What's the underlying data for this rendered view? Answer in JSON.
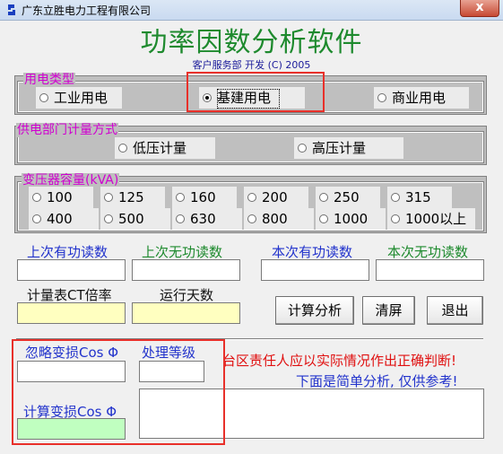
{
  "window": {
    "title": "广东立胜电力工程有限公司",
    "close_glyph": "x"
  },
  "header": {
    "title": "功率因数分析软件",
    "subtitle": "客户服务部 开发 (C) 2005"
  },
  "usage_type": {
    "label": "用电类型",
    "options": [
      {
        "label": "工业用电",
        "selected": false
      },
      {
        "label": "基建用电",
        "selected": true
      },
      {
        "label": "商业用电",
        "selected": false
      }
    ]
  },
  "metering": {
    "label": "供电部门计量方式",
    "options": [
      {
        "label": "低压计量",
        "selected": false
      },
      {
        "label": "高压计量",
        "selected": false
      }
    ]
  },
  "capacity": {
    "label": "变压器容量(kVA)",
    "options": [
      "100",
      "125",
      "160",
      "200",
      "250",
      "315",
      "400",
      "500",
      "630",
      "800",
      "1000",
      "1000以上"
    ]
  },
  "readings": {
    "last_active": "上次有功读数",
    "last_reactive": "上次无功读数",
    "this_active": "本次有功读数",
    "this_reactive": "本次无功读数",
    "ct_ratio": "计量表CT倍率",
    "run_days": "运行天数"
  },
  "buttons": {
    "calculate": "计算分析",
    "clear": "清屏",
    "exit": "退出"
  },
  "results": {
    "ignore_loss": "忽略变损Cos Φ",
    "grade": "处理等级",
    "calc_loss": "计算变损Cos Φ"
  },
  "notice": {
    "line1": "台区责任人应以实际情况作出正确判断!",
    "line2": "下面是简单分析, 仅供参考!"
  },
  "colors": {
    "accent_title": "#1e8a2e",
    "group_label": "#d000d0",
    "highlight": "#e8302a"
  }
}
